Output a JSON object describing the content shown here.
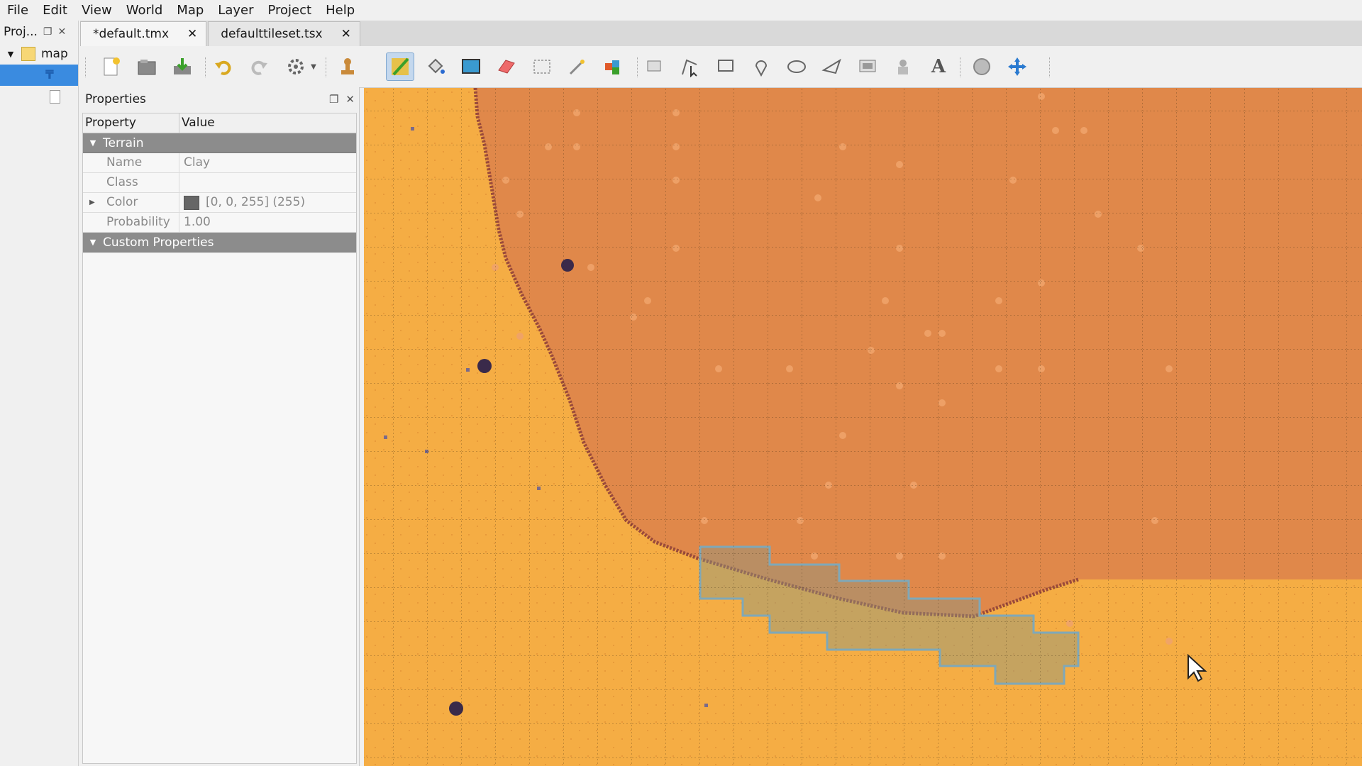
{
  "menu": [
    "File",
    "Edit",
    "View",
    "World",
    "Map",
    "Layer",
    "Project",
    "Help"
  ],
  "project": {
    "title": "Proj...",
    "root": "map"
  },
  "tabs": [
    {
      "label": "*default.tmx",
      "active": true
    },
    {
      "label": "defaulttileset.tsx",
      "active": false
    }
  ],
  "toolbar": {
    "buttons": [
      "new-map-icon",
      "open-icon",
      "save-icon",
      "undo-icon",
      "redo-icon",
      "commands-icon",
      "stamp-icon",
      "terrain-brush-icon",
      "bucket-fill-icon",
      "shape-fill-icon",
      "eraser-icon",
      "rect-select-icon",
      "magic-wand-icon",
      "select-same-tile-icon",
      "select-objects-icon",
      "edit-polygons-icon",
      "insert-rectangle-icon",
      "insert-point-icon",
      "insert-ellipse-icon",
      "insert-polygon-icon",
      "insert-tile-icon",
      "insert-template-icon",
      "insert-text-icon",
      "world-tool-icon",
      "move-icon"
    ],
    "active": "terrain-brush-icon"
  },
  "properties": {
    "title": "Properties",
    "col_property": "Property",
    "col_value": "Value",
    "group_terrain": "Terrain",
    "group_custom": "Custom Properties",
    "rows": [
      {
        "name": "Name",
        "value": "Clay"
      },
      {
        "name": "Class",
        "value": ""
      },
      {
        "name": "Color",
        "value": "[0, 0, 255] (255)",
        "swatch": "#666666"
      },
      {
        "name": "Probability",
        "value": "1.00"
      }
    ]
  },
  "colors": {
    "sand": "#f5ad44",
    "clay": "#e0884a",
    "clay_edge": "#9a4a3a",
    "highlight_border": "#7fa8b8",
    "accent": "#3a8be0"
  }
}
